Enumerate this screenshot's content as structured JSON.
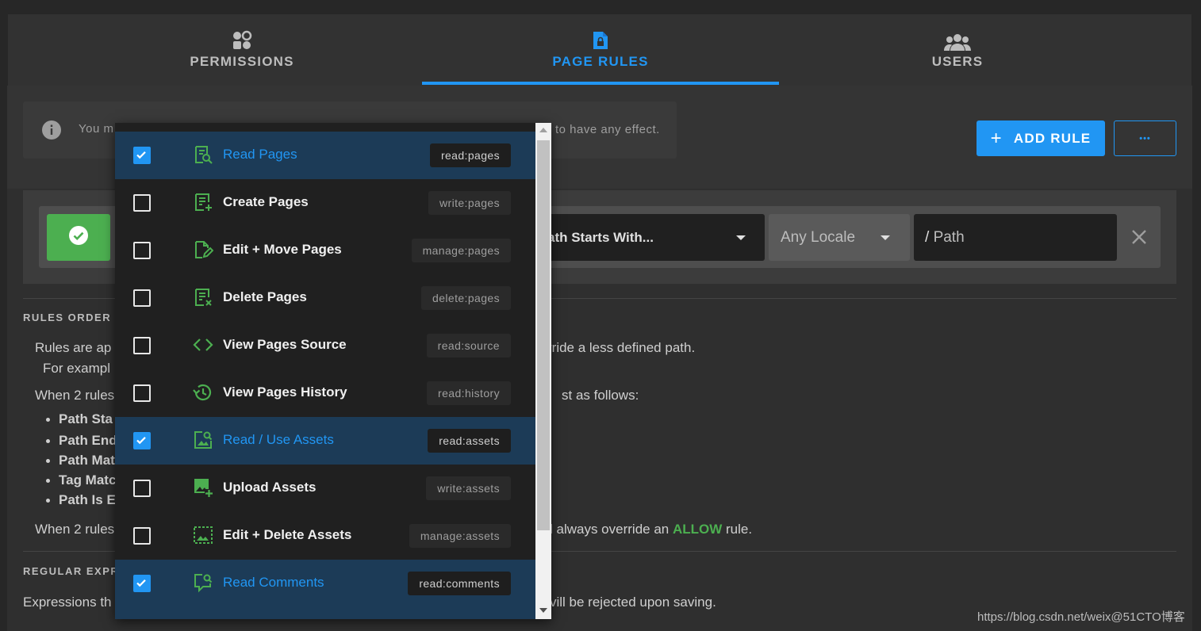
{
  "tabs": [
    {
      "label": "PERMISSIONS",
      "icon": "permissions-icon",
      "active": false
    },
    {
      "label": "PAGE RULES",
      "icon": "page-lock-icon",
      "active": true
    },
    {
      "label": "USERS",
      "icon": "users-icon",
      "active": false
    }
  ],
  "alert": {
    "text_left": "You m",
    "text_right": "to have any effect."
  },
  "toolbar": {
    "add_rule_label": "ADD RULE",
    "more_label": "•••"
  },
  "rule": {
    "match": "ath Starts With...",
    "locale": "Any Locale",
    "path_prefix": "/",
    "path_placeholder": "Path"
  },
  "help": {
    "rules_order_title": "RULES ORDER",
    "p1_left": "Rules are ap",
    "p1_right": "rride a less defined path.",
    "p2_left": "For exampl",
    "p3_left": "When 2 rules",
    "p3_right": "st as follows:",
    "bullets": [
      "Path Sta",
      "Path End",
      "Path Mat",
      "Tag Matc",
      "Path Is E"
    ],
    "p4_left": "When 2 rules",
    "p4_mid": "l always override an ",
    "p4_allow": "ALLOW",
    "p4_end": " rule.",
    "regex_title": "REGULAR EXPRE",
    "p5_left": "Expressions th",
    "p5_right": "vill be rejected upon saving."
  },
  "menu_items": [
    {
      "label": "Read Pages",
      "scope": "read:pages",
      "checked": true,
      "icon": "file-search-icon"
    },
    {
      "label": "Create Pages",
      "scope": "write:pages",
      "checked": false,
      "icon": "file-plus-icon"
    },
    {
      "label": "Edit + Move Pages",
      "scope": "manage:pages",
      "checked": false,
      "icon": "file-edit-icon"
    },
    {
      "label": "Delete Pages",
      "scope": "delete:pages",
      "checked": false,
      "icon": "file-remove-icon"
    },
    {
      "label": "View Pages Source",
      "scope": "read:source",
      "checked": false,
      "icon": "code-icon"
    },
    {
      "label": "View Pages History",
      "scope": "read:history",
      "checked": false,
      "icon": "history-icon"
    },
    {
      "label": "Read / Use Assets",
      "scope": "read:assets",
      "checked": true,
      "icon": "image-search-icon"
    },
    {
      "label": "Upload Assets",
      "scope": "write:assets",
      "checked": false,
      "icon": "image-plus-icon"
    },
    {
      "label": "Edit + Delete Assets",
      "scope": "manage:assets",
      "checked": false,
      "icon": "image-edit-icon"
    },
    {
      "label": "Read Comments",
      "scope": "read:comments",
      "checked": true,
      "icon": "comment-search-icon"
    }
  ],
  "watermark": "https://blog.csdn.net/weix@51CTO博客",
  "colors": {
    "accent": "#2196f3",
    "allow": "#4caf50",
    "icon_green": "#4caf50",
    "selected_row": "#1c3b57"
  }
}
